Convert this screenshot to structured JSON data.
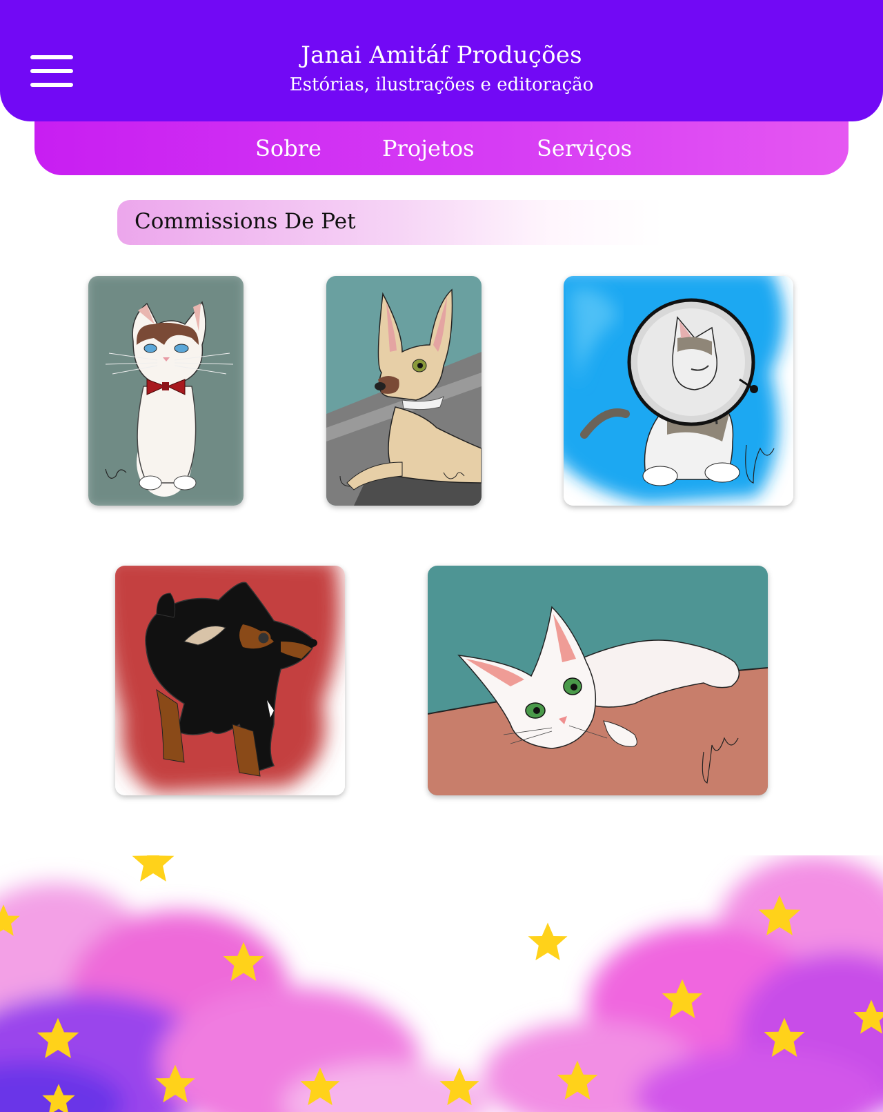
{
  "header": {
    "title": "Janai Amitáf Produções",
    "subtitle": "Estórias, ilustrações e editoração",
    "menu_icon": "hamburger-menu-icon",
    "background_color": "#7209f5"
  },
  "nav": {
    "items": [
      {
        "label": "Sobre"
      },
      {
        "label": "Projetos"
      },
      {
        "label": "Serviços"
      }
    ],
    "background_color": "#c81ef2"
  },
  "section": {
    "title": "Commissions De Pet"
  },
  "gallery": {
    "items": [
      {
        "subject": "cat-with-red-bowtie"
      },
      {
        "subject": "tan-dog-with-collar"
      },
      {
        "subject": "kitten-with-cone"
      },
      {
        "subject": "black-and-tan-small-dog"
      },
      {
        "subject": "white-cat-lying-down"
      }
    ]
  },
  "colors": {
    "accent_purple": "#7209f5",
    "accent_magenta": "#c81ef2",
    "star_yellow": "#ffd21a",
    "cloud_pink": "#f06ad8"
  }
}
